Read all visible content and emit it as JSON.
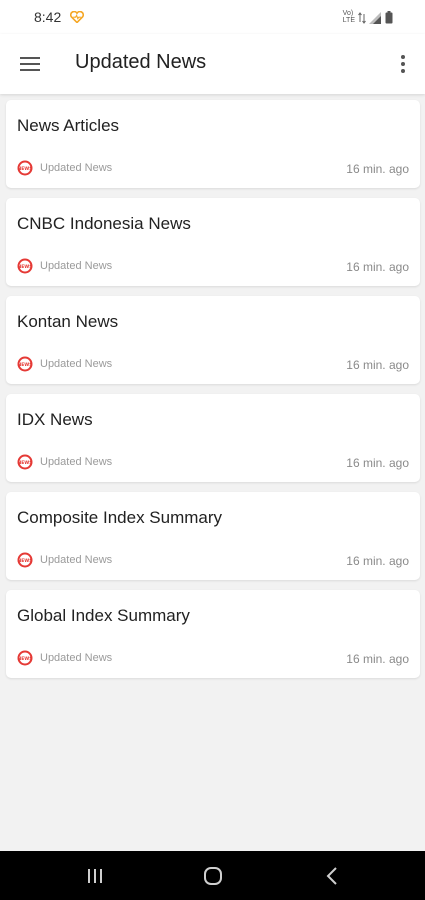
{
  "status_bar": {
    "time": "8:42",
    "volte_line1": "Vo)",
    "volte_line2": "LTE"
  },
  "app_bar": {
    "title": "Updated News",
    "menu_icon": "hamburger-menu-icon",
    "more_icon": "more-vert-icon"
  },
  "articles": [
    {
      "title": "News Articles",
      "source": "Updated News",
      "time": "16 min. ago"
    },
    {
      "title": "CNBC Indonesia News",
      "source": "Updated News",
      "time": "16 min. ago"
    },
    {
      "title": "Kontan News",
      "source": "Updated News",
      "time": "16 min. ago"
    },
    {
      "title": "IDX News",
      "source": "Updated News",
      "time": "16 min. ago"
    },
    {
      "title": "Composite Index Summary",
      "source": "Updated News",
      "time": "16 min. ago"
    },
    {
      "title": "Global Index Summary",
      "source": "Updated News",
      "time": "16 min. ago"
    }
  ],
  "source_logo_text": "NEWS",
  "colors": {
    "accent": "#e53935",
    "heart": "#f5a623",
    "nav_bar": "#000000"
  },
  "nav_bar": {
    "recents_icon": "recents-icon",
    "home_icon": "home-icon",
    "back_icon": "back-icon"
  }
}
